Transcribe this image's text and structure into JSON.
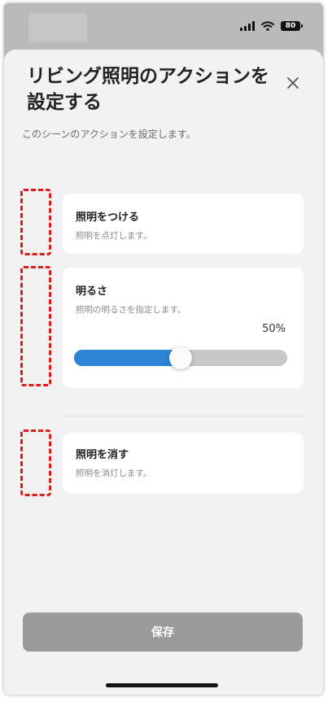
{
  "status_bar": {
    "battery": "80"
  },
  "sheet": {
    "title": "リビング照明のアクションを設定する",
    "subtitle": "このシーンのアクションを設定します。",
    "close_icon": "close-icon"
  },
  "actions": [
    {
      "title": "照明をつける",
      "description": "照明を点灯します。"
    },
    {
      "title": "明るさ",
      "description": "照明の明るさを指定します。",
      "value_label": "50%",
      "value": 50
    },
    {
      "title": "照明を消す",
      "description": "照明を消灯します。"
    }
  ],
  "footer": {
    "save_label": "保存"
  },
  "colors": {
    "accent": "#2b84d6",
    "drop_slot": "#e0191b",
    "save_button": "#9b9b9b",
    "sheet_bg": "#f2f2f2"
  }
}
